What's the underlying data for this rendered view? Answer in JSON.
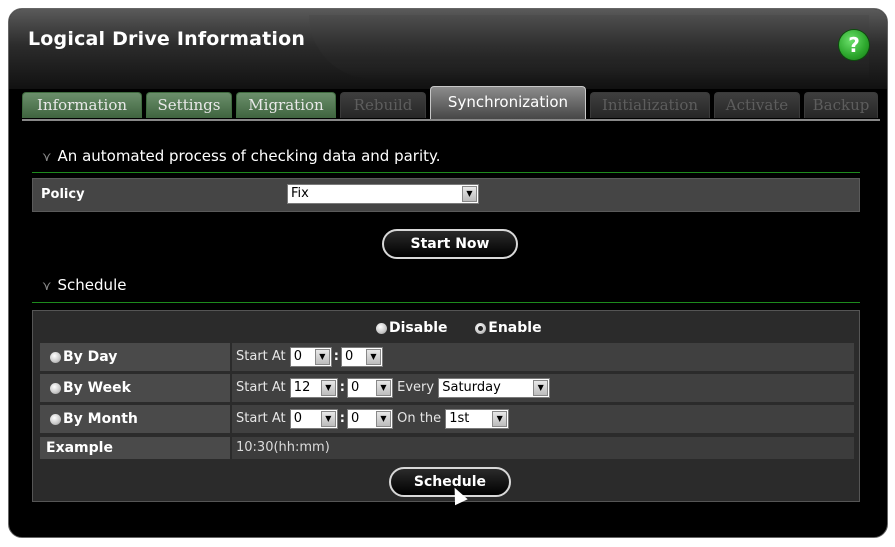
{
  "window": {
    "title": "Logical Drive Information",
    "help_label": "?"
  },
  "tabs": [
    {
      "label": "Information",
      "state": "enabled"
    },
    {
      "label": "Settings",
      "state": "enabled"
    },
    {
      "label": "Migration",
      "state": "enabled"
    },
    {
      "label": "Rebuild",
      "state": "disabled"
    },
    {
      "label": "Synchronization",
      "state": "active"
    },
    {
      "label": "Initialization",
      "state": "disabled"
    },
    {
      "label": "Activate",
      "state": "disabled"
    },
    {
      "label": "Backup",
      "state": "disabled"
    }
  ],
  "sync": {
    "description": "An automated process of checking data and parity.",
    "policy_label": "Policy",
    "policy_value": "Fix",
    "start_now_label": "Start Now"
  },
  "schedule": {
    "heading": "Schedule",
    "disable_label": "Disable",
    "enable_label": "Enable",
    "enabled": true,
    "start_at_label": "Start At",
    "every_label": "Every",
    "on_the_label": "On the",
    "by_day": {
      "label": "By Day",
      "hour": "0",
      "minute": "0"
    },
    "by_week": {
      "label": "By Week",
      "hour": "12",
      "minute": "0",
      "day": "Saturday"
    },
    "by_month": {
      "label": "By Month",
      "hour": "0",
      "minute": "0",
      "date": "1st"
    },
    "example_label": "Example",
    "example_value": "10:30(hh:mm)",
    "button_label": "Schedule"
  },
  "colors": {
    "accent_green": "#1d8a1d",
    "help_green": "#2faa2f",
    "panel_bg": "#000000"
  }
}
